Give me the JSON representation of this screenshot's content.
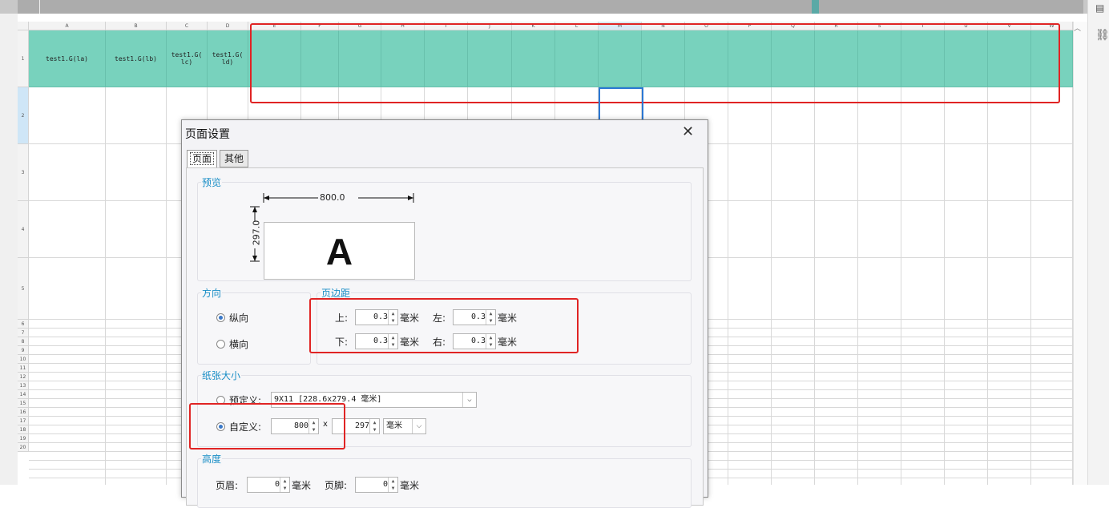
{
  "sheet": {
    "headers": [
      {
        "label": "A"
      },
      {
        "label": "B"
      },
      {
        "label": "C"
      },
      {
        "label": "D"
      },
      {
        "label": "E"
      },
      {
        "label": "F"
      },
      {
        "label": "G"
      },
      {
        "label": "H"
      },
      {
        "label": "I"
      },
      {
        "label": "J"
      },
      {
        "label": "K"
      },
      {
        "label": "L"
      },
      {
        "label": "M"
      },
      {
        "label": "N"
      },
      {
        "label": "O"
      },
      {
        "label": "P"
      },
      {
        "label": "Q"
      },
      {
        "label": "R"
      },
      {
        "label": "S"
      },
      {
        "label": "T"
      },
      {
        "label": "U"
      },
      {
        "label": "V"
      },
      {
        "label": "W"
      }
    ],
    "rows": [
      "1",
      "2",
      "3",
      "4",
      "5",
      "6",
      "7",
      "8",
      "9",
      "10",
      "11",
      "12",
      "13",
      "14",
      "15",
      "16",
      "17",
      "18",
      "19",
      "20"
    ],
    "row1_cells": [
      "test1.G(la)",
      "test1.G(lb)",
      "test1.G(\nlc)",
      "test1.G(\nld)"
    ],
    "header_color": "#78d2bd"
  },
  "dialog": {
    "title": "页面设置",
    "tabs": [
      {
        "label": "页面"
      },
      {
        "label": "其他"
      }
    ],
    "preview": {
      "title": "预览",
      "width_label": "800.0",
      "height_label": "297.0",
      "letter": "A"
    },
    "orientation": {
      "title": "方向",
      "portrait": "纵向",
      "landscape": "横向",
      "selected": "portrait"
    },
    "margins": {
      "title": "页边距",
      "top_label": "上:",
      "top_value": "0.3",
      "left_label": "左:",
      "left_value": "0.3",
      "bottom_label": "下:",
      "bottom_value": "0.3",
      "right_label": "右:",
      "right_value": "0.3",
      "unit": "毫米"
    },
    "paper": {
      "title": "纸张大小",
      "predefined_label": "预定义:",
      "predefined_value": "9X11 [228.6x279.4 毫米]",
      "custom_label": "自定义:",
      "custom_width": "800",
      "times": "x",
      "custom_height": "297",
      "unit": "毫米",
      "selected": "custom"
    },
    "height": {
      "title": "高度",
      "header_label": "页眉:",
      "header_value": "0",
      "footer_label": "页脚:",
      "footer_value": "0",
      "unit": "毫米"
    }
  }
}
